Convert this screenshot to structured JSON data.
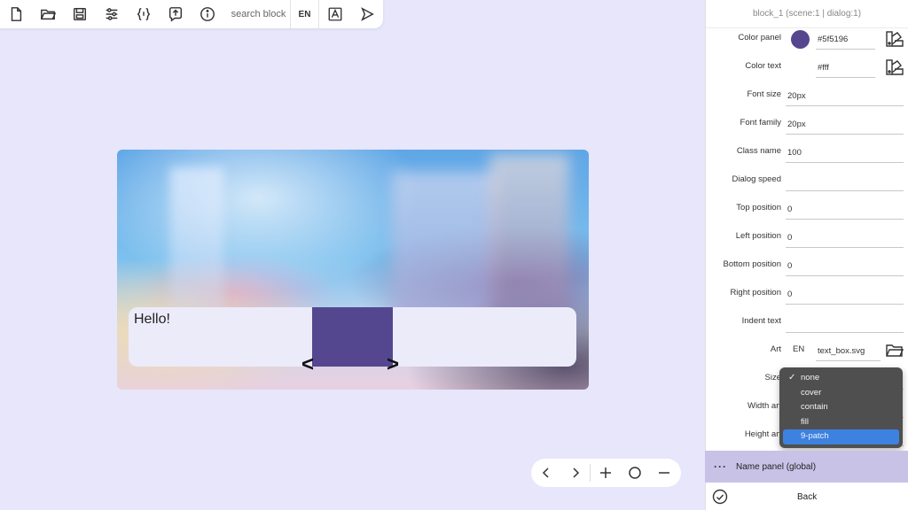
{
  "toolbar": {
    "icons": [
      "new-file-icon",
      "open-folder-icon",
      "save-icon",
      "sliders-icon",
      "code-braces-icon",
      "upload-icon",
      "info-icon"
    ],
    "search_placeholder": "search block",
    "lang": "EN",
    "translate_icon": "translate-icon",
    "play_icon": "play-icon"
  },
  "stage": {
    "dialog_text": "Hello!",
    "prev_arrow": "<",
    "next_arrow": ">",
    "art_color": "#54478f"
  },
  "zoom": {
    "icons": [
      "chevron-left-icon",
      "chevron-right-icon",
      "zoom-in-icon",
      "reset-zoom-icon",
      "zoom-out-icon"
    ]
  },
  "panel": {
    "header": "block_1 (scene:1 | dialog:1)",
    "color_panel_label": "Color panel",
    "color_panel_value": "#5f5196",
    "color_panel_swatch": "#54478f",
    "color_text_label": "Color text",
    "color_text_value": "#fff",
    "font_size_label": "Font size",
    "font_size_value": "20px",
    "font_family_label": "Font family",
    "font_family_value": "20px",
    "class_name_label": "Class name",
    "class_name_value": "100",
    "dialog_speed_label": "Dialog speed",
    "dialog_speed_value": "",
    "top_position_label": "Top position",
    "top_position_value": "0",
    "left_position_label": "Left position",
    "left_position_value": "0",
    "bottom_position_label": "Bottom position",
    "bottom_position_value": "0",
    "right_position_label": "Right position",
    "right_position_value": "0",
    "indent_text_label": "Indent text",
    "indent_text_value": "",
    "art_label": "Art",
    "art_lang": "EN",
    "art_value": "text_box.svg",
    "size_label": "Size",
    "width_art_label": "Width art",
    "height_art_label": "Height art",
    "size_options": [
      "none",
      "cover",
      "contain",
      "fill",
      "9-patch"
    ],
    "size_checked": "none",
    "size_highlighted": "9-patch"
  },
  "name_panel": {
    "label": "Name panel (global)"
  },
  "back": {
    "label": "Back"
  }
}
